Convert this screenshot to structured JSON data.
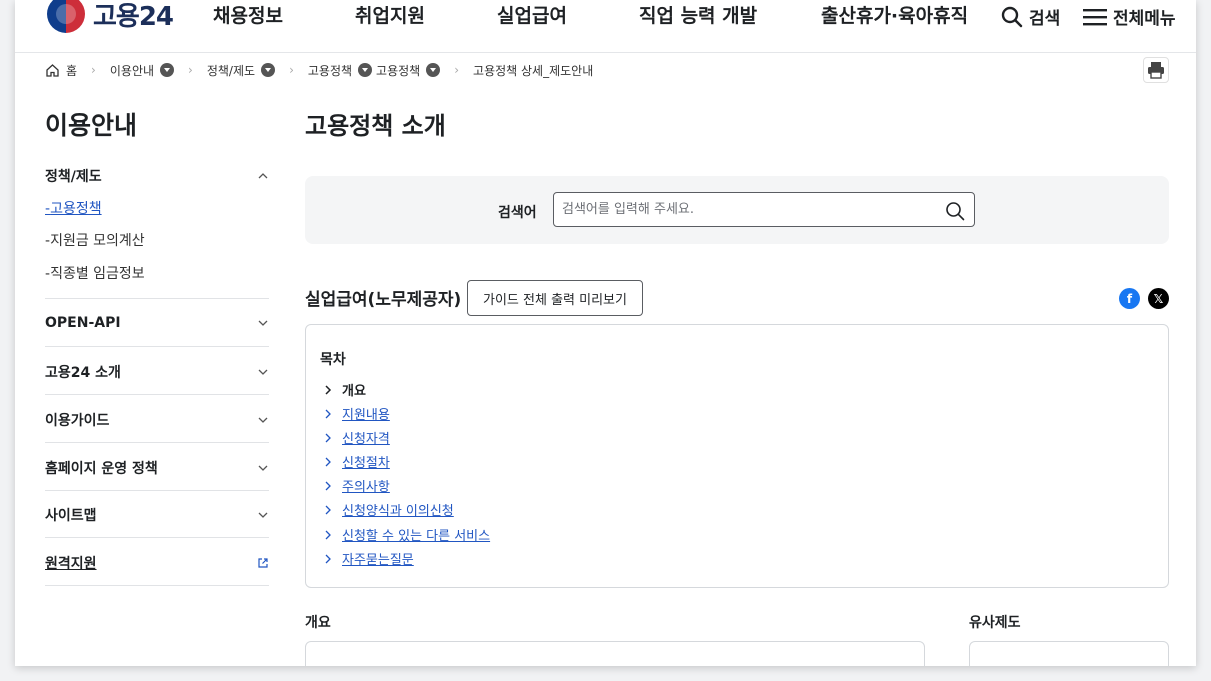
{
  "header": {
    "logo_text": "고용24",
    "menu": [
      "채용정보",
      "취업지원",
      "실업급여",
      "직업 능력 개발",
      "출산휴가·육아휴직"
    ],
    "search_label": "검색",
    "all_menu_label": "전체메뉴"
  },
  "breadcrumb": {
    "home": "홈",
    "items": [
      "이용안내",
      "정책/제도",
      "고용정책",
      "고용정책",
      "고용정책 상세_제도안내"
    ]
  },
  "sidebar": {
    "title": "이용안내",
    "sections": [
      {
        "label": "정책/제도",
        "expanded": true,
        "children": [
          "고용정책",
          "지원금 모의계산",
          "직종별 임금정보"
        ]
      },
      {
        "label": "OPEN-API"
      },
      {
        "label": "고용24 소개"
      },
      {
        "label": "이용가이드"
      },
      {
        "label": "홈페이지 운영 정책"
      },
      {
        "label": "사이트맵"
      },
      {
        "label": "원격지원"
      }
    ]
  },
  "main": {
    "title": "고용정책 소개",
    "search": {
      "label": "검색어",
      "placeholder": "검색어를 입력해 주세요."
    },
    "guide_title": "실업급여(노무제공자)",
    "guide_button": "가이드 전체 출력 미리보기",
    "toc": {
      "title": "목차",
      "items": [
        "개요",
        "지원내용",
        "신청자격",
        "신청절차",
        "주의사항",
        "신청양식과 이의신청",
        "신청할 수 있는 다른 서비스",
        "자주묻는질문"
      ]
    },
    "overview_title": "개요",
    "similar_title": "유사제도"
  },
  "colors": {
    "accent": "#2156c2",
    "facebook": "#1877f2",
    "x": "#000000"
  }
}
